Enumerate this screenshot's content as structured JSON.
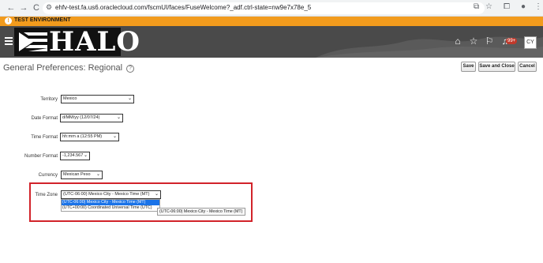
{
  "browser": {
    "back_icon": "←",
    "forward_icon": "→",
    "reload_icon": "C",
    "url": "ehfv-test.fa.us6.oraclecloud.com/fscmUI/faces/FuseWelcome?_adf.ctrl-state=nw9e7x78e_5"
  },
  "environment": {
    "label": "TEST ENVIRONMENT",
    "bar_color": "#f29b1d"
  },
  "header": {
    "logo_text": "HALO",
    "notification_count": "99+",
    "user_initials": "CY",
    "icons": [
      "home-icon",
      "star-icon",
      "flag-icon",
      "bell-icon"
    ]
  },
  "page": {
    "title": "General Preferences: Regional",
    "help_icon": "?",
    "buttons": {
      "save": "Save",
      "save_and_close": "Save and Close",
      "cancel": "Cancel"
    }
  },
  "form": {
    "territory": {
      "label": "Territory",
      "value": "Mexico"
    },
    "date_format": {
      "label": "Date Format",
      "value": "d/MM/yy (12/07/24)"
    },
    "time_format": {
      "label": "Time Format",
      "value": "hh:mm a (12:55 PM)"
    },
    "number_format": {
      "label": "Number Format",
      "value": "-1,234.567"
    },
    "currency": {
      "label": "Currency",
      "value": "Mexican Peso"
    },
    "time_zone": {
      "label": "Time Zone",
      "value": "(UTC-06:00) Mexico City - Mexico Time (MT)",
      "options": [
        "(UTC-06:00) Mexico City - Mexico Time (MT)",
        "(UTC+00:00) Coordinated Universal Time (UTC)"
      ],
      "tooltip": "(UTC-06:00) Mexico City - Mexico Time (MT)"
    }
  },
  "colors": {
    "header_bg": "#4a4a4a",
    "highlight": "#d2232a",
    "selected_option": "#1a73e8"
  }
}
